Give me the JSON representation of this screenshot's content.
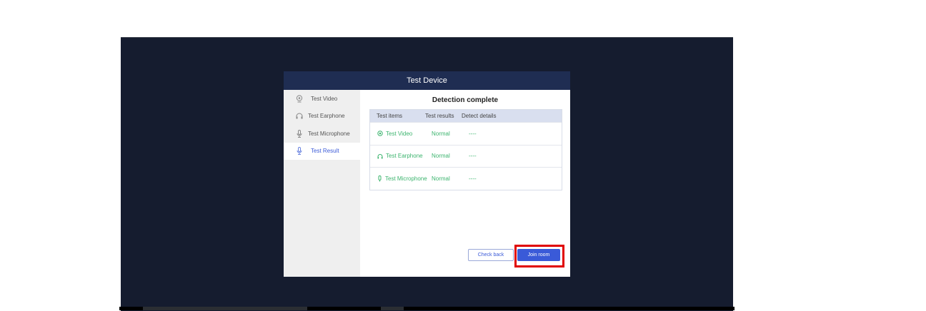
{
  "modal": {
    "title": "Test Device",
    "sidebar": [
      {
        "label": "Test Video",
        "icon": "camera-icon"
      },
      {
        "label": "Test Earphone",
        "icon": "headphones-icon"
      },
      {
        "label": "Test Microphone",
        "icon": "microphone-icon"
      },
      {
        "label": "Test Result",
        "icon": "microphone-icon",
        "active": true
      }
    ],
    "detection_title": "Detection complete",
    "table": {
      "headers": [
        "Test items",
        "Test results",
        "Detect details"
      ],
      "rows": [
        {
          "item": "Test Video",
          "result": "Normal",
          "details": "----",
          "icon": "camera-icon"
        },
        {
          "item": "Test Earphone",
          "result": "Normal",
          "details": "----",
          "icon": "headphones-icon"
        },
        {
          "item": "Test Microphone",
          "result": "Normal",
          "details": "----",
          "icon": "microphone-icon"
        }
      ]
    },
    "buttons": {
      "check_back": "Check back",
      "join_room": "Join room"
    }
  },
  "colors": {
    "accent": "#3a5ad8",
    "success": "#3cb46e",
    "header": "#1f2d52",
    "highlight": "#e00000"
  }
}
